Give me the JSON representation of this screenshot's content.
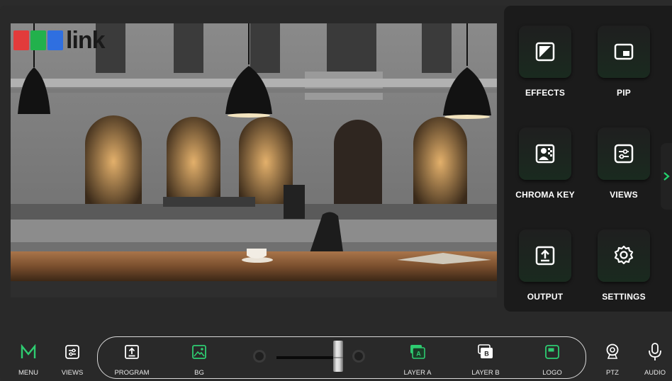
{
  "brand": {
    "logo_text": "link",
    "logo_colors": [
      "#e23b3b",
      "#22b14c",
      "#2f6fe0"
    ]
  },
  "side_panel": {
    "tiles": [
      {
        "label": "EFFECTS",
        "icon": "effects-icon"
      },
      {
        "label": "PIP",
        "icon": "pip-icon"
      },
      {
        "label": "CHROMA KEY",
        "icon": "chroma-key-icon"
      },
      {
        "label": "VIEWS",
        "icon": "views-icon"
      },
      {
        "label": "OUTPUT",
        "icon": "output-icon"
      },
      {
        "label": "SETTINGS",
        "icon": "settings-gear-icon"
      }
    ],
    "expand_icon": "chevron-right-icon",
    "accent": "#22d36e"
  },
  "bottom_bar": {
    "menu": "MENU",
    "views": "VIEWS",
    "program": "PROGRAM",
    "bg": "BG",
    "layer_a": "LAYER A",
    "layer_b": "LAYER B",
    "logo": "LOGO",
    "ptz": "PTZ",
    "audio": "AUDIO",
    "layer_a_badge": "A",
    "layer_b_badge": "B",
    "active_color": "#2ecc71"
  }
}
